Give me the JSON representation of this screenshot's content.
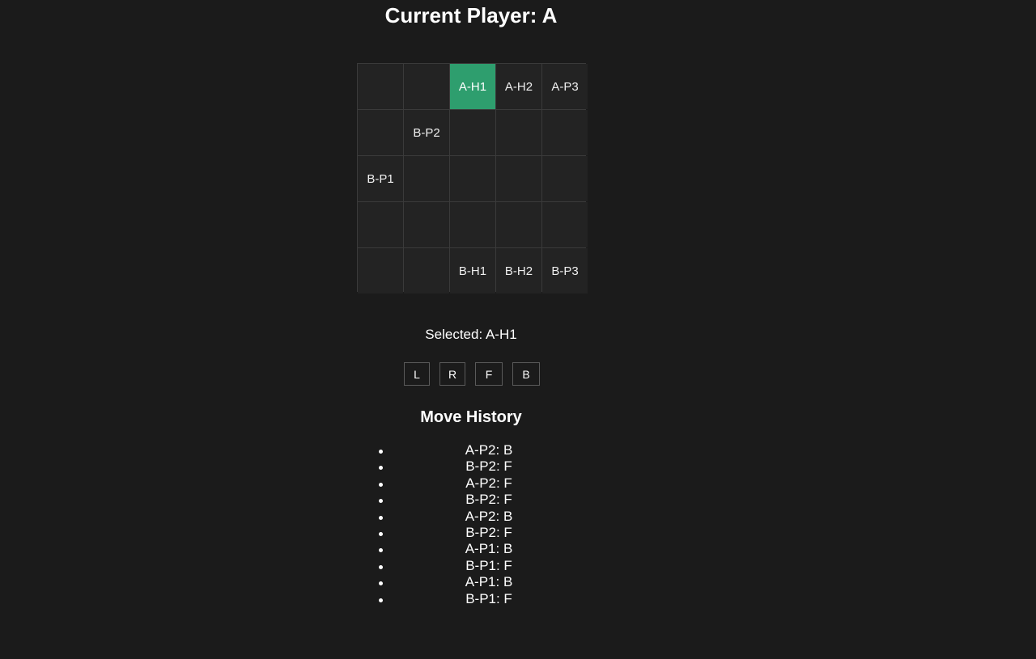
{
  "header": {
    "title": "Current Player: A"
  },
  "board": {
    "rows": [
      [
        "",
        "",
        "A-H1",
        "A-H2",
        "A-P3"
      ],
      [
        "",
        "B-P2",
        "",
        "",
        ""
      ],
      [
        "B-P1",
        "",
        "",
        "",
        ""
      ],
      [
        "",
        "",
        "",
        "",
        ""
      ],
      [
        "",
        "",
        "B-H1",
        "B-H2",
        "B-P3"
      ]
    ],
    "selected_cell": "A-H1",
    "selected_color": "#2e9e6e"
  },
  "selection": {
    "label": "Selected: A-H1"
  },
  "controls": {
    "left_label": "L",
    "right_label": "R",
    "forward_label": "F",
    "back_label": "B"
  },
  "history": {
    "title": "Move History",
    "moves": [
      "A-P2: B",
      "B-P2: F",
      "A-P2: F",
      "B-P2: F",
      "A-P2: B",
      "B-P2: F",
      "A-P1: B",
      "B-P1: F",
      "A-P1: B",
      "B-P1: F"
    ]
  }
}
